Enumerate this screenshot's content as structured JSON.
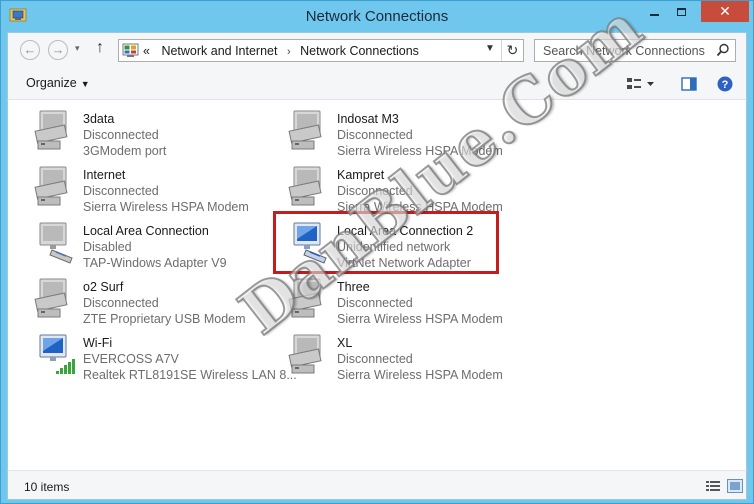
{
  "window": {
    "title": "Network Connections",
    "close_glyph": "✕"
  },
  "nav": {
    "back_glyph": "←",
    "forward_glyph": "→",
    "up_glyph": "↑",
    "breadcrumb_prefix": "«",
    "breadcrumb": [
      "Network and Internet",
      "Network Connections"
    ],
    "breadcrumb_sep": "›",
    "refresh_glyph": "↻",
    "search_placeholder": "Search Network Connections"
  },
  "toolbar": {
    "organize_label": "Organize",
    "organize_caret": "▼"
  },
  "connections": [
    {
      "name": "3data",
      "status": "Disconnected",
      "adapter": "3GModem port",
      "kind": "modem"
    },
    {
      "name": "Indosat M3",
      "status": "Disconnected",
      "adapter": "Sierra Wireless HSPA Modem",
      "kind": "modem"
    },
    {
      "name": "Internet",
      "status": "Disconnected",
      "adapter": "Sierra Wireless HSPA Modem",
      "kind": "modem"
    },
    {
      "name": "Kampret",
      "status": "Disconnected",
      "adapter": "Sierra Wireless HSPA Modem",
      "kind": "modem"
    },
    {
      "name": "Local Area Connection",
      "status": "Disabled",
      "adapter": "TAP-Windows Adapter V9",
      "kind": "ethernet-disabled"
    },
    {
      "name": "Local Area Connection 2",
      "status": "Unidentified network",
      "adapter": "VirtNet Network Adapter",
      "kind": "ethernet-active"
    },
    {
      "name": "o2 Surf",
      "status": "Disconnected",
      "adapter": "ZTE Proprietary USB Modem",
      "kind": "modem"
    },
    {
      "name": "Three",
      "status": "Disconnected",
      "adapter": "Sierra Wireless HSPA Modem",
      "kind": "modem"
    },
    {
      "name": "Wi-Fi",
      "status": "EVERCOSS A7V",
      "adapter": "Realtek RTL8191SE Wireless LAN 8...",
      "kind": "wifi"
    },
    {
      "name": "XL",
      "status": "Disconnected",
      "adapter": "Sierra Wireless HSPA Modem",
      "kind": "modem"
    }
  ],
  "statusbar": {
    "item_count": "10 items"
  },
  "watermark": {
    "text": "DanBlue.Com"
  },
  "colors": {
    "accent": "#70c7ee",
    "close": "#c74c3c",
    "highlight": "#c41d1d"
  }
}
